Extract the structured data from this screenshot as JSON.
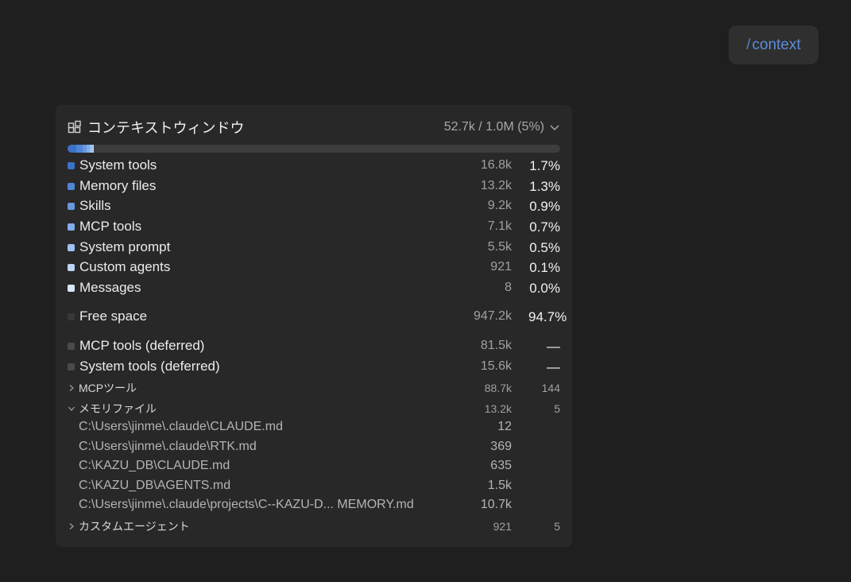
{
  "command": {
    "slash": "/",
    "name": "context"
  },
  "panel": {
    "title": "コンテキストウィンドウ",
    "usage": "52.7k / 1.0M (5%)",
    "bar_segments": [
      {
        "color": "#3a73c9",
        "fraction": 0.017
      },
      {
        "color": "#4f86d6",
        "fraction": 0.013
      },
      {
        "color": "#6798df",
        "fraction": 0.009
      },
      {
        "color": "#82acea",
        "fraction": 0.007
      },
      {
        "color": "#9fc1f1",
        "fraction": 0.005
      },
      {
        "color": "#bcd5f6",
        "fraction": 0.001
      }
    ],
    "rows": [
      {
        "label": "System tools",
        "value": "16.8k",
        "percent": "1.7%",
        "color": "#3a73c9"
      },
      {
        "label": "Memory files",
        "value": "13.2k",
        "percent": "1.3%",
        "color": "#4f86d6"
      },
      {
        "label": "Skills",
        "value": "9.2k",
        "percent": "0.9%",
        "color": "#6798df"
      },
      {
        "label": "MCP tools",
        "value": "7.1k",
        "percent": "0.7%",
        "color": "#82acea"
      },
      {
        "label": "System prompt",
        "value": "5.5k",
        "percent": "0.5%",
        "color": "#9fc1f1"
      },
      {
        "label": "Custom agents",
        "value": "921",
        "percent": "0.1%",
        "color": "#bcd5f6"
      },
      {
        "label": "Messages",
        "value": "8",
        "percent": "0.0%",
        "color": "#d8e6fa"
      },
      {
        "label": "Free space",
        "value": "947.2k",
        "percent": "94.7%",
        "color": "#383838"
      },
      {
        "label": "MCP tools (deferred)",
        "value": "81.5k",
        "percent": "—",
        "color": "#4a4a4a"
      },
      {
        "label": "System tools (deferred)",
        "value": "15.6k",
        "percent": "—",
        "color": "#4a4a4a"
      }
    ],
    "groups": {
      "mcp": {
        "label": "MCPツール",
        "value": "88.7k",
        "count": "144"
      },
      "memory": {
        "label": "メモリファイル",
        "value": "13.2k",
        "count": "5"
      },
      "agents": {
        "label": "カスタムエージェント",
        "value": "921",
        "count": "5"
      }
    },
    "memory_files": [
      {
        "path": "C:\\Users\\jinme\\.claude\\CLAUDE.md",
        "value": "12"
      },
      {
        "path": "C:\\Users\\jinme\\.claude\\RTK.md",
        "value": "369"
      },
      {
        "path": "C:\\KAZU_DB\\CLAUDE.md",
        "value": "635"
      },
      {
        "path": "C:\\KAZU_DB\\AGENTS.md",
        "value": "1.5k"
      },
      {
        "path": "C:\\Users\\jinme\\.claude\\projects\\C--KAZU-D... MEMORY.md",
        "value": "10.7k"
      }
    ]
  }
}
